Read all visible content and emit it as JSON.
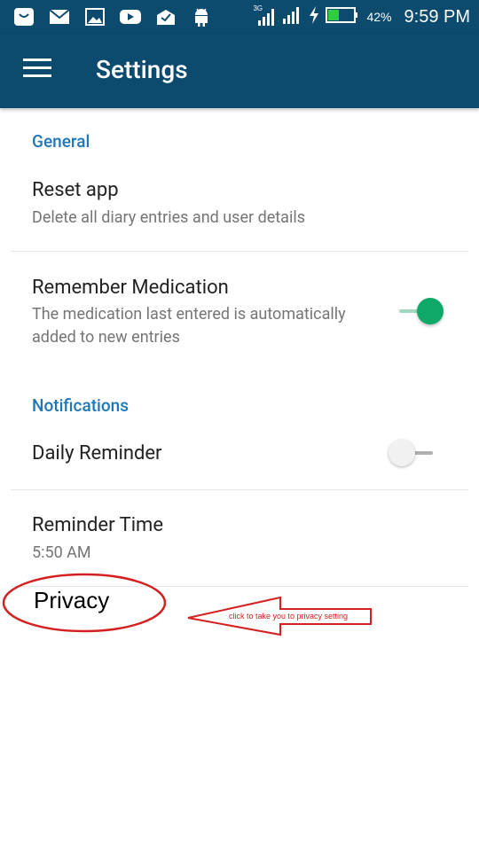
{
  "status_bar": {
    "icons": [
      "notification-icon",
      "mail-icon",
      "gallery-icon",
      "youtube-icon",
      "inbox-icon",
      "android-icon"
    ],
    "network": "3G",
    "battery_percent": "42%",
    "time": "9:59 PM"
  },
  "app_bar": {
    "title": "Settings"
  },
  "sections": {
    "general": {
      "header": "General",
      "reset": {
        "title": "Reset app",
        "subtitle": "Delete all diary entries and user details"
      },
      "medication": {
        "title": "Remember Medication",
        "subtitle": "The medication last entered is automatically added to new entries",
        "enabled": true
      }
    },
    "notifications": {
      "header": "Notifications",
      "daily_reminder": {
        "title": "Daily Reminder",
        "enabled": false
      },
      "reminder_time": {
        "title": "Reminder Time",
        "value": "5:50 AM"
      }
    }
  },
  "privacy": {
    "label": "Privacy"
  },
  "annotation": {
    "text": "click to take you to privacy setting",
    "color": "#d42020"
  },
  "colors": {
    "primary": "#0c4a6e",
    "accent": "#1e78b8",
    "switch_on": "#0fa868"
  }
}
